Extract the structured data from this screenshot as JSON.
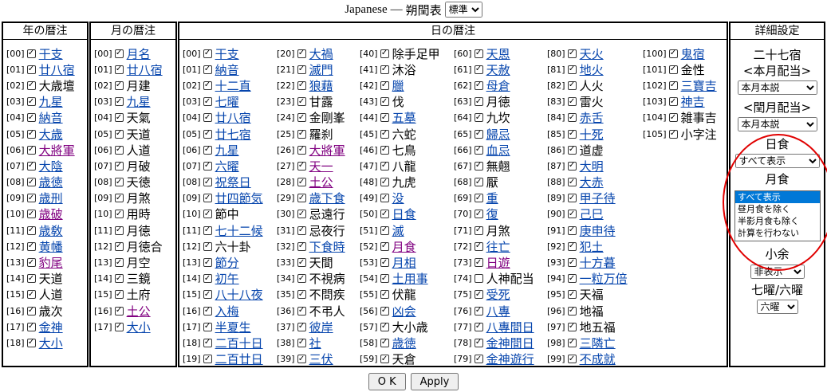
{
  "header": {
    "prefix": "Japanese",
    "dash": "—",
    "title": "朔閏表",
    "mode_selected": "標準"
  },
  "panels": {
    "year": "年の暦注",
    "month": "月の暦注",
    "day": "日の暦注",
    "settings": "詳細設定"
  },
  "year_items": [
    {
      "idx": "[00]",
      "label": "干支",
      "style": "link"
    },
    {
      "idx": "[01]",
      "label": "廿八宿",
      "style": "link"
    },
    {
      "idx": "[02]",
      "label": "大歳壇",
      "style": "plain"
    },
    {
      "idx": "[03]",
      "label": "九星",
      "style": "link"
    },
    {
      "idx": "[04]",
      "label": "納音",
      "style": "link"
    },
    {
      "idx": "[05]",
      "label": "大歳",
      "style": "link"
    },
    {
      "idx": "[06]",
      "label": "大將軍",
      "style": "visited"
    },
    {
      "idx": "[07]",
      "label": "大陰",
      "style": "link"
    },
    {
      "idx": "[08]",
      "label": "歳徳",
      "style": "link"
    },
    {
      "idx": "[09]",
      "label": "歳刑",
      "style": "link"
    },
    {
      "idx": "[10]",
      "label": "歳破",
      "style": "visited"
    },
    {
      "idx": "[11]",
      "label": "歳敎",
      "style": "link"
    },
    {
      "idx": "[12]",
      "label": "黄幡",
      "style": "link"
    },
    {
      "idx": "[13]",
      "label": "豹尾",
      "style": "visited"
    },
    {
      "idx": "[14]",
      "label": "天道",
      "style": "plain"
    },
    {
      "idx": "[15]",
      "label": "人道",
      "style": "plain"
    },
    {
      "idx": "[16]",
      "label": "歳次",
      "style": "plain"
    },
    {
      "idx": "[17]",
      "label": "金神",
      "style": "link"
    },
    {
      "idx": "[18]",
      "label": "大小",
      "style": "link"
    }
  ],
  "month_items": [
    {
      "idx": "[00]",
      "label": "月名",
      "style": "link"
    },
    {
      "idx": "[01]",
      "label": "廿八宿",
      "style": "link"
    },
    {
      "idx": "[02]",
      "label": "月建",
      "style": "plain"
    },
    {
      "idx": "[03]",
      "label": "九星",
      "style": "link"
    },
    {
      "idx": "[04]",
      "label": "天氣",
      "style": "plain"
    },
    {
      "idx": "[05]",
      "label": "天道",
      "style": "plain"
    },
    {
      "idx": "[06]",
      "label": "人道",
      "style": "plain"
    },
    {
      "idx": "[07]",
      "label": "月破",
      "style": "plain"
    },
    {
      "idx": "[08]",
      "label": "天徳",
      "style": "plain"
    },
    {
      "idx": "[09]",
      "label": "月煞",
      "style": "plain"
    },
    {
      "idx": "[10]",
      "label": "用時",
      "style": "plain"
    },
    {
      "idx": "[11]",
      "label": "月徳",
      "style": "plain"
    },
    {
      "idx": "[12]",
      "label": "月徳合",
      "style": "plain"
    },
    {
      "idx": "[13]",
      "label": "月空",
      "style": "plain"
    },
    {
      "idx": "[14]",
      "label": "三鏡",
      "style": "plain"
    },
    {
      "idx": "[15]",
      "label": "土府",
      "style": "plain"
    },
    {
      "idx": "[16]",
      "label": "土公",
      "style": "visited"
    },
    {
      "idx": "[17]",
      "label": "大小",
      "style": "link"
    }
  ],
  "day_columns": [
    [
      {
        "idx": "[00]",
        "label": "干支",
        "style": "link"
      },
      {
        "idx": "[01]",
        "label": "納音",
        "style": "link"
      },
      {
        "idx": "[02]",
        "label": "十二直",
        "style": "link"
      },
      {
        "idx": "[03]",
        "label": "七曜",
        "style": "link"
      },
      {
        "idx": "[04]",
        "label": "廿八宿",
        "style": "link"
      },
      {
        "idx": "[05]",
        "label": "廿七宿",
        "style": "link"
      },
      {
        "idx": "[06]",
        "label": "九星",
        "style": "link"
      },
      {
        "idx": "[07]",
        "label": "六曜",
        "style": "link"
      },
      {
        "idx": "[08]",
        "label": "祝祭日",
        "style": "link"
      },
      {
        "idx": "[09]",
        "label": "廿四節気",
        "style": "link"
      },
      {
        "idx": "[10]",
        "label": "節中",
        "style": "plain"
      },
      {
        "idx": "[11]",
        "label": "七十二候",
        "style": "link"
      },
      {
        "idx": "[12]",
        "label": "六十卦",
        "style": "plain"
      },
      {
        "idx": "[13]",
        "label": "節分",
        "style": "link"
      },
      {
        "idx": "[14]",
        "label": "初午",
        "style": "link"
      },
      {
        "idx": "[15]",
        "label": "八十八夜",
        "style": "link"
      },
      {
        "idx": "[16]",
        "label": "入梅",
        "style": "link"
      },
      {
        "idx": "[17]",
        "label": "半夏生",
        "style": "link"
      },
      {
        "idx": "[18]",
        "label": "二百十日",
        "style": "link"
      },
      {
        "idx": "[19]",
        "label": "二百廿日",
        "style": "link"
      }
    ],
    [
      {
        "idx": "[20]",
        "label": "大禍",
        "style": "link"
      },
      {
        "idx": "[21]",
        "label": "滅門",
        "style": "link"
      },
      {
        "idx": "[22]",
        "label": "狼藉",
        "style": "link"
      },
      {
        "idx": "[23]",
        "label": "甘露",
        "style": "plain"
      },
      {
        "idx": "[24]",
        "label": "金剛峯",
        "style": "plain"
      },
      {
        "idx": "[25]",
        "label": "羅刹",
        "style": "plain"
      },
      {
        "idx": "[26]",
        "label": "大將軍",
        "style": "visited"
      },
      {
        "idx": "[27]",
        "label": "天一",
        "style": "visited"
      },
      {
        "idx": "[28]",
        "label": "土公",
        "style": "visited"
      },
      {
        "idx": "[29]",
        "label": "歳下食",
        "style": "link"
      },
      {
        "idx": "[30]",
        "label": "忌遠行",
        "style": "plain"
      },
      {
        "idx": "[31]",
        "label": "忌夜行",
        "style": "plain"
      },
      {
        "idx": "[32]",
        "label": "下食時",
        "style": "link"
      },
      {
        "idx": "[33]",
        "label": "天間",
        "style": "plain"
      },
      {
        "idx": "[34]",
        "label": "不視病",
        "style": "plain"
      },
      {
        "idx": "[35]",
        "label": "不問疾",
        "style": "plain"
      },
      {
        "idx": "[36]",
        "label": "不弔人",
        "style": "plain"
      },
      {
        "idx": "[37]",
        "label": "彼岸",
        "style": "link"
      },
      {
        "idx": "[38]",
        "label": "社",
        "style": "link"
      },
      {
        "idx": "[39]",
        "label": "三伏",
        "style": "link"
      }
    ],
    [
      {
        "idx": "[40]",
        "label": "除手足甲",
        "style": "plain"
      },
      {
        "idx": "[41]",
        "label": "沐浴",
        "style": "plain"
      },
      {
        "idx": "[42]",
        "label": "臘",
        "style": "link"
      },
      {
        "idx": "[43]",
        "label": "伐",
        "style": "plain"
      },
      {
        "idx": "[44]",
        "label": "五墓",
        "style": "link"
      },
      {
        "idx": "[45]",
        "label": "六蛇",
        "style": "plain"
      },
      {
        "idx": "[46]",
        "label": "七鳥",
        "style": "plain"
      },
      {
        "idx": "[47]",
        "label": "八龍",
        "style": "plain"
      },
      {
        "idx": "[48]",
        "label": "九虎",
        "style": "plain"
      },
      {
        "idx": "[49]",
        "label": "没",
        "style": "link"
      },
      {
        "idx": "[50]",
        "label": "日食",
        "style": "link"
      },
      {
        "idx": "[51]",
        "label": "滅",
        "style": "link"
      },
      {
        "idx": "[52]",
        "label": "月食",
        "style": "visited"
      },
      {
        "idx": "[53]",
        "label": "月相",
        "style": "link"
      },
      {
        "idx": "[54]",
        "label": "土用事",
        "style": "link"
      },
      {
        "idx": "[55]",
        "label": "伏龍",
        "style": "plain"
      },
      {
        "idx": "[56]",
        "label": "凶会",
        "style": "link"
      },
      {
        "idx": "[57]",
        "label": "大小歳",
        "style": "plain"
      },
      {
        "idx": "[58]",
        "label": "歳徳",
        "style": "link"
      },
      {
        "idx": "[59]",
        "label": "天倉",
        "style": "plain"
      }
    ],
    [
      {
        "idx": "[60]",
        "label": "天恩",
        "style": "link"
      },
      {
        "idx": "[61]",
        "label": "天赦",
        "style": "link"
      },
      {
        "idx": "[62]",
        "label": "母倉",
        "style": "link"
      },
      {
        "idx": "[63]",
        "label": "月徳",
        "style": "plain"
      },
      {
        "idx": "[64]",
        "label": "九坎",
        "style": "plain"
      },
      {
        "idx": "[65]",
        "label": "歸忌",
        "style": "link"
      },
      {
        "idx": "[66]",
        "label": "血忌",
        "style": "link"
      },
      {
        "idx": "[67]",
        "label": "無翹",
        "style": "plain"
      },
      {
        "idx": "[68]",
        "label": "厭",
        "style": "plain"
      },
      {
        "idx": "[69]",
        "label": "重",
        "style": "link"
      },
      {
        "idx": "[70]",
        "label": "復",
        "style": "link"
      },
      {
        "idx": "[71]",
        "label": "月煞",
        "style": "plain"
      },
      {
        "idx": "[72]",
        "label": "往亡",
        "style": "link"
      },
      {
        "idx": "[73]",
        "label": "日遊",
        "style": "visited"
      },
      {
        "idx": "[74]",
        "label": "人神配当",
        "style": "plain",
        "unchecked": true
      },
      {
        "idx": "[75]",
        "label": "受死",
        "style": "link"
      },
      {
        "idx": "[76]",
        "label": "八專",
        "style": "link"
      },
      {
        "idx": "[77]",
        "label": "八專間日",
        "style": "link"
      },
      {
        "idx": "[78]",
        "label": "金神間日",
        "style": "link"
      },
      {
        "idx": "[79]",
        "label": "金神遊行",
        "style": "link"
      }
    ],
    [
      {
        "idx": "[80]",
        "label": "天火",
        "style": "link"
      },
      {
        "idx": "[81]",
        "label": "地火",
        "style": "link"
      },
      {
        "idx": "[82]",
        "label": "人火",
        "style": "plain"
      },
      {
        "idx": "[83]",
        "label": "雷火",
        "style": "plain"
      },
      {
        "idx": "[84]",
        "label": "赤舌",
        "style": "link"
      },
      {
        "idx": "[85]",
        "label": "十死",
        "style": "link"
      },
      {
        "idx": "[86]",
        "label": "道虚",
        "style": "plain"
      },
      {
        "idx": "[87]",
        "label": "大明",
        "style": "link"
      },
      {
        "idx": "[88]",
        "label": "大赤",
        "style": "link"
      },
      {
        "idx": "[89]",
        "label": "甲子待",
        "style": "link"
      },
      {
        "idx": "[90]",
        "label": "己巳",
        "style": "link"
      },
      {
        "idx": "[91]",
        "label": "庚申待",
        "style": "link"
      },
      {
        "idx": "[92]",
        "label": "犯土",
        "style": "link"
      },
      {
        "idx": "[93]",
        "label": "十方暮",
        "style": "link"
      },
      {
        "idx": "[94]",
        "label": "一粒万倍",
        "style": "link"
      },
      {
        "idx": "[95]",
        "label": "天福",
        "style": "plain"
      },
      {
        "idx": "[96]",
        "label": "地福",
        "style": "plain"
      },
      {
        "idx": "[97]",
        "label": "地五福",
        "style": "plain"
      },
      {
        "idx": "[98]",
        "label": "三隣亡",
        "style": "link"
      },
      {
        "idx": "[99]",
        "label": "不成就",
        "style": "link"
      }
    ],
    [
      {
        "idx": "[100]",
        "label": "鬼宿",
        "style": "link"
      },
      {
        "idx": "[101]",
        "label": "金性",
        "style": "plain"
      },
      {
        "idx": "[102]",
        "label": "三寶吉",
        "style": "link"
      },
      {
        "idx": "[103]",
        "label": "神吉",
        "style": "link"
      },
      {
        "idx": "[104]",
        "label": "雑事吉",
        "style": "plain"
      },
      {
        "idx": "[105]",
        "label": "小字注",
        "style": "plain"
      }
    ]
  ],
  "settings": {
    "s27": "二十七宿",
    "honmon": "<本月配当>",
    "honmon_select": "本月本説",
    "urumon": "<閏月配当>",
    "urumon_select": "本月本説",
    "nisshoku": "日食",
    "nisshoku_select": "すべて表示",
    "gesshoku": "月食",
    "gesshoku_options": [
      "すべて表示",
      "昼月食を除く",
      "半影月食も除く",
      "計算を行わない"
    ],
    "shoyo": "小余",
    "shoyo_select": "非表示",
    "shichiyo": "七曜/六曜",
    "shichiyo_select": "六曜"
  },
  "footer": {
    "ok": "O K",
    "apply": "Apply"
  },
  "check_glyph": "✓",
  "highlight_color": "#e00000"
}
